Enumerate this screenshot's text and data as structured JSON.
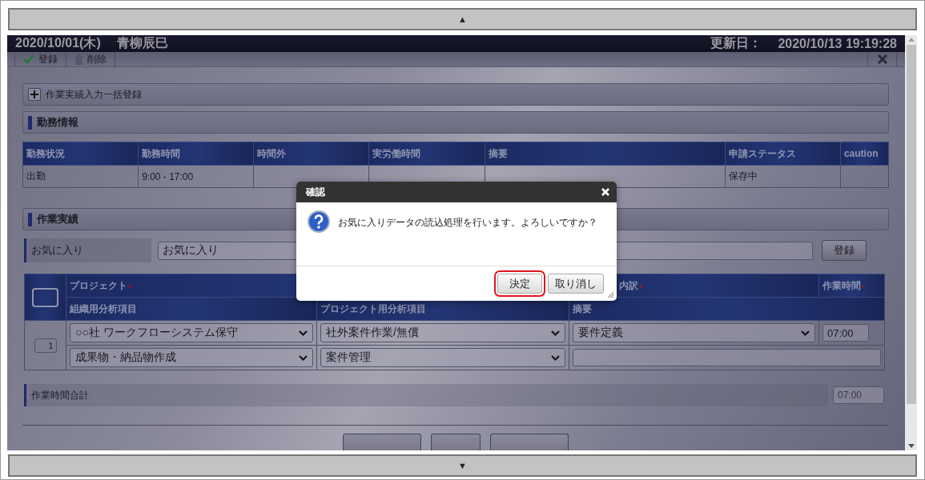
{
  "scroll_up": "▲",
  "scroll_down": "▼",
  "header": {
    "date": "2020/10/01(木)",
    "name": "青柳辰巳",
    "updated_label": "更新日：",
    "updated": "2020/10/13 19:19:28"
  },
  "toolbar": [
    {
      "label": "登録",
      "kind": "check"
    },
    {
      "label": "削除",
      "kind": "trash"
    }
  ],
  "bulk_section": {
    "title": "作業実績入力一括登録",
    "expanded": false
  },
  "attendance": {
    "title": "勤務情報",
    "columns": [
      "勤務状況",
      "勤務時間",
      "時間外",
      "実労働時間",
      "摘要",
      "申請ステータス",
      "caution"
    ],
    "rows": [
      [
        "出勤",
        "9:00 - 17:00",
        null,
        null,
        null,
        "保存中",
        null
      ]
    ]
  },
  "work": {
    "title": "作業実績",
    "favorite": {
      "label": "お気に入り",
      "value": "お気に入り",
      "button": "登録"
    },
    "select_all": {
      "checked": false
    },
    "header_top": [
      {
        "label": "プロジェクト",
        "required": true
      },
      {
        "label": "内訳",
        "required": true
      },
      {
        "label": "作業時間",
        "required": true
      }
    ],
    "header_bottom": [
      "組織用分析項目",
      "プロジェクト用分析項目",
      "摘要"
    ],
    "rows": [
      {
        "number": "1",
        "project": "○○社 ワークフローシステム保守",
        "project_item": "社外案件作業/無償",
        "process": "要件定義",
        "hours": "07:00",
        "org_item": "成果物・納品物作成",
        "project_item_2": "案件管理"
      }
    ],
    "total": {
      "label": "作業時間合計",
      "value": "07:00"
    }
  },
  "dialog": {
    "title": "確認",
    "message": "お気に入りデータの読込処理を行います。よろしいですか？",
    "buttons": [
      {
        "label": "決定",
        "selected": true
      },
      {
        "label": "取り消し",
        "selected": false
      }
    ]
  }
}
